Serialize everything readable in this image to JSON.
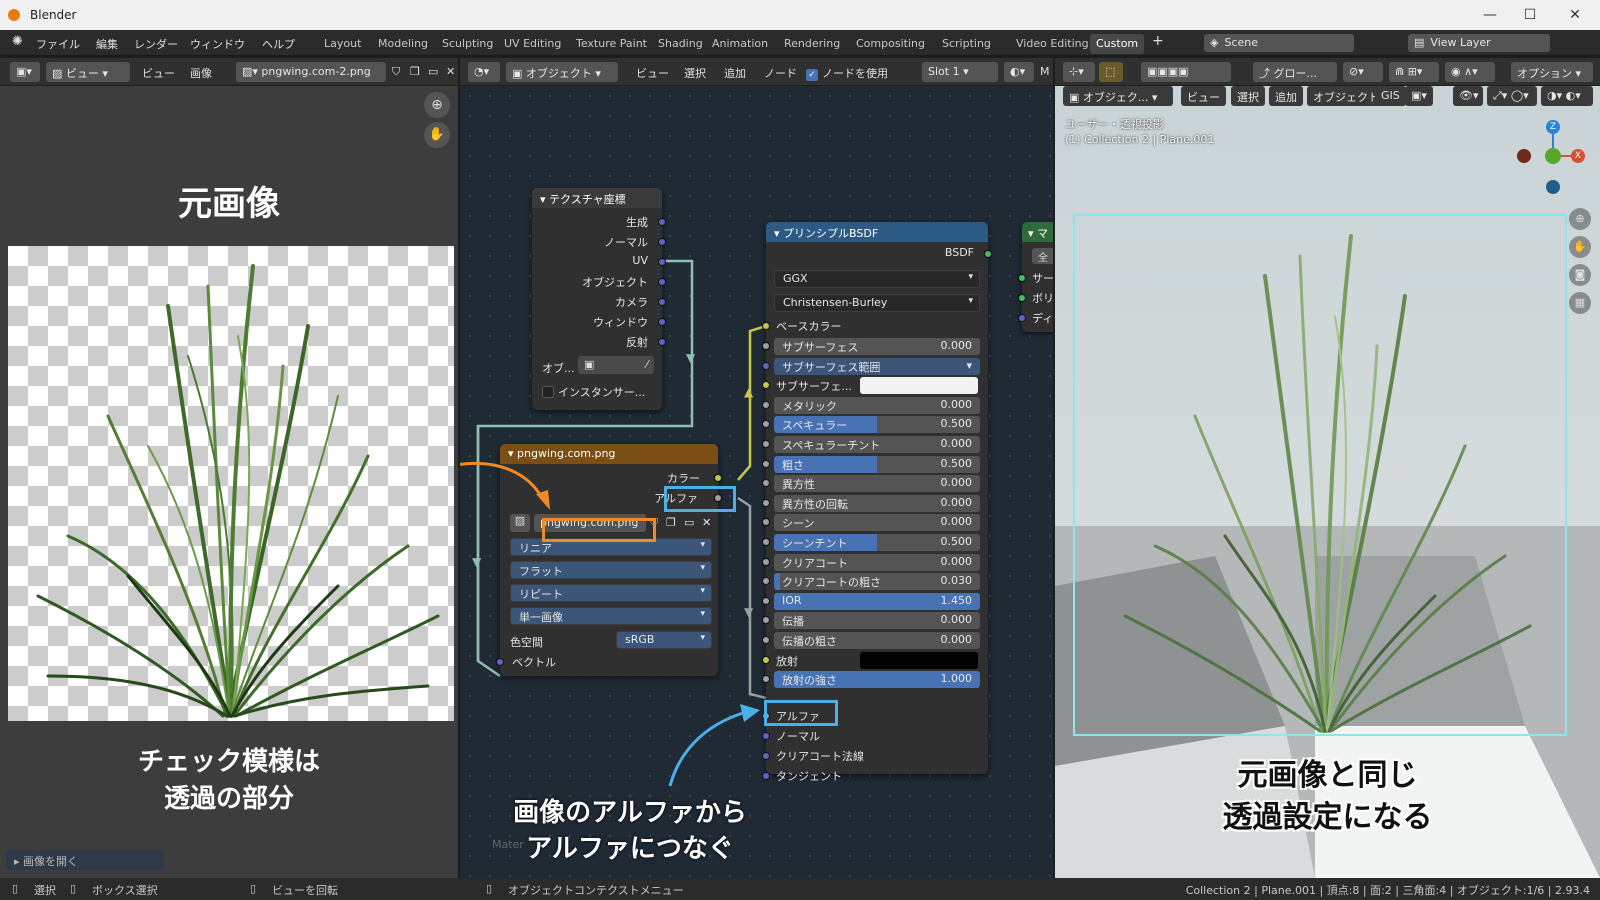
{
  "window": {
    "app_title": "Blender",
    "min": "—",
    "max": "☐",
    "close": "✕"
  },
  "menu": [
    "ファイル",
    "編集",
    "レンダー",
    "ウィンドウ",
    "ヘルプ"
  ],
  "workspaces": [
    "Layout",
    "Modeling",
    "Sculpting",
    "UV Editing",
    "Texture Paint",
    "Shading",
    "Animation",
    "Rendering",
    "Compositing",
    "Scripting",
    "Video Editing",
    "Custom"
  ],
  "active_workspace": "Custom",
  "add_workspace": "+",
  "scene": "Scene",
  "view_layer": "View Layer",
  "image_editor": {
    "header": {
      "view_dd": "ビュー",
      "view": "ビュー",
      "image": "画像",
      "image_name": "pngwing.com-2.png"
    },
    "title": "元画像",
    "caption_l1": "チェック模様は",
    "caption_l2": "透過の部分",
    "open_image": "画像を開く"
  },
  "node_editor": {
    "header": {
      "object": "オブジェクト",
      "view": "ビュー",
      "select": "選択",
      "add": "追加",
      "node": "ノード",
      "use_nodes": "ノードを使用",
      "slot": "Slot 1",
      "m": "M"
    },
    "texcoord": {
      "title": "テクスチャ座標",
      "outputs": [
        "生成",
        "ノーマル",
        "UV",
        "オブジェクト",
        "カメラ",
        "ウィンドウ",
        "反射"
      ],
      "obj_label": "オブ...",
      "instancer": "インスタンサー..."
    },
    "image_node": {
      "title": "pngwing.com.png",
      "out_color": "カラー",
      "out_alpha": "アルファ",
      "image": "pngwing.com.png",
      "interp": "リニア",
      "proj": "フラット",
      "ext": "リピート",
      "source": "単一画像",
      "colorspace_label": "色空間",
      "colorspace": "sRGB",
      "vector": "ベクトル"
    },
    "bsdf": {
      "title": "プリンシプルBSDF",
      "output": "BSDF",
      "dist": "GGX",
      "sss_method": "Christensen-Burley",
      "base_color": "ベースカラー",
      "rows": [
        {
          "label": "サブサーフェス",
          "value": "0.000",
          "fill": 0
        },
        {
          "label": "サブサーフェス範囲",
          "value": "",
          "fill": 1,
          "dropdown": true
        },
        {
          "label": "サブサーフェ...",
          "value": "",
          "fill": 0,
          "color": "#f2f2f2"
        },
        {
          "label": "メタリック",
          "value": "0.000",
          "fill": 0
        },
        {
          "label": "スペキュラー",
          "value": "0.500",
          "fill": 0.5
        },
        {
          "label": "スペキュラーチント",
          "value": "0.000",
          "fill": 0
        },
        {
          "label": "粗さ",
          "value": "0.500",
          "fill": 0.5
        },
        {
          "label": "異方性",
          "value": "0.000",
          "fill": 0
        },
        {
          "label": "異方性の回転",
          "value": "0.000",
          "fill": 0
        },
        {
          "label": "シーン",
          "value": "0.000",
          "fill": 0
        },
        {
          "label": "シーンチント",
          "value": "0.500",
          "fill": 0.5
        },
        {
          "label": "クリアコート",
          "value": "0.000",
          "fill": 0
        },
        {
          "label": "クリアコートの粗さ",
          "value": "0.030",
          "fill": 0.03
        },
        {
          "label": "IOR",
          "value": "1.450",
          "fill": 1
        },
        {
          "label": "伝播",
          "value": "0.000",
          "fill": 0
        },
        {
          "label": "伝播の粗さ",
          "value": "0.000",
          "fill": 0
        },
        {
          "label": "放射",
          "value": "",
          "fill": 0,
          "color": "#000000"
        },
        {
          "label": "放射の強さ",
          "value": "1.000",
          "fill": 1
        }
      ],
      "alpha": "アルファ",
      "normal": "ノーマル",
      "clearcoat_normal": "クリアコート法線",
      "tangent": "タンジェント"
    },
    "output_node": {
      "title": "マ",
      "all": "全",
      "rows": [
        "サー",
        "ボリ",
        "ディ"
      ]
    },
    "caption_l1": "画像のアルファから",
    "caption_l2": "アルファにつなぐ",
    "material_label": "Mater"
  },
  "viewport": {
    "header": {
      "object": "オブジェク...",
      "view": "ビュー",
      "select": "選択",
      "add": "追加",
      "object_menu": "オブジェクト",
      "gis": "GIS",
      "global": "グロー...",
      "options": "オプション"
    },
    "perspective": "ユーザー・透視投影",
    "collection": "(1) Collection 2 | Plane.001",
    "gizmo_z": "Z",
    "gizmo_x": "X",
    "caption_l1": "元画像と同じ",
    "caption_l2": "透過設定になる"
  },
  "statusbar": {
    "select": "選択",
    "box_select": "ボックス選択",
    "rotate": "ビューを回転",
    "context": "オブジェクトコンテクストメニュー",
    "info": "Collection 2 | Plane.001 | 頂点:8 | 面:2 | 三角面:4 | オブジェクト:1/6 | 2.93.4"
  },
  "colors": {
    "accent": "#4772b3",
    "callout_orange": "#f08a24",
    "callout_blue": "#4ab0e8",
    "node_image_header": "#7a4e14",
    "node_bsdf_header": "#2b5a84",
    "node_tc_header": "#3a3a3a"
  }
}
